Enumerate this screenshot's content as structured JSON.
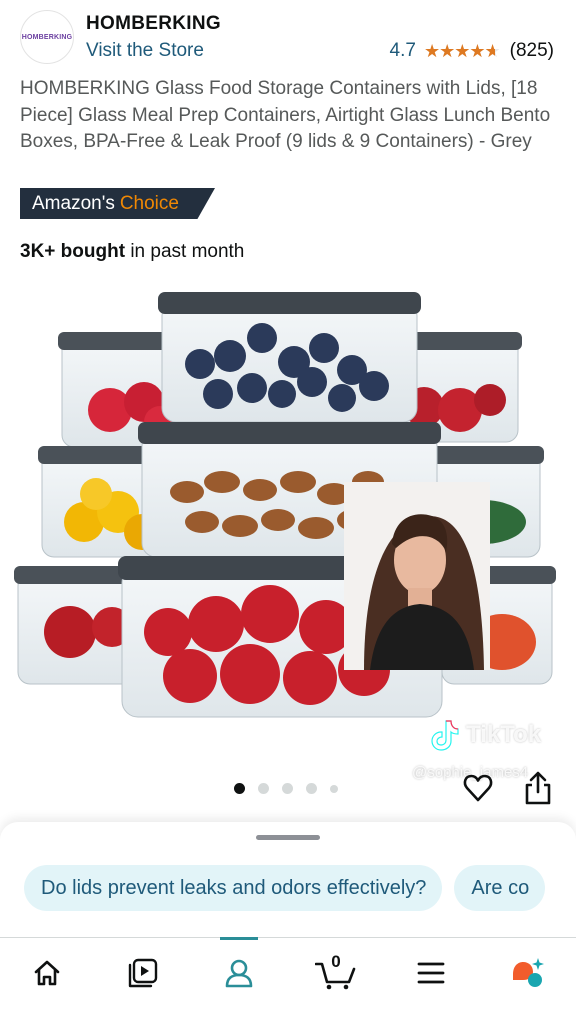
{
  "store": {
    "logo_text": "HOMBERKING",
    "name": "HOMBERKING",
    "visit_link": "Visit the Store",
    "rating_value": "4.7",
    "rating_fraction": 0.94,
    "stars_glyph": "★★★★★",
    "review_count": "(825)"
  },
  "product": {
    "title": "HOMBERKING Glass Food Storage Containers with Lids, [18 Piece] Glass Meal Prep Containers, Airtight Glass Lunch Bento Boxes, BPA-Free & Leak Proof (9 lids & 9 Containers) - Grey",
    "badge_prefix": "Amazon's",
    "badge_suffix": "Choice",
    "bought_strong": "3K+ bought",
    "bought_rest": "in past month"
  },
  "overlay": {
    "tiktok_label": "TikTok",
    "tiktok_handle": "@sophie_james4"
  },
  "carousel": {
    "count": 5,
    "active_index": 0
  },
  "questions": [
    "Do lids prevent leaks and odors effectively?",
    "Are co"
  ],
  "bottom_nav": {
    "items": [
      "home-icon",
      "video-icon",
      "account-icon",
      "cart-icon",
      "menu-icon",
      "rufus-icon"
    ],
    "active": "account-icon",
    "cart_count": "0"
  },
  "colors": {
    "link": "#1f5a7a",
    "star": "#de7921",
    "badge_bg": "#232f3e",
    "badge_accent": "#f08804",
    "chip_bg": "#e2f4f8",
    "nav_active": "#2a8e98"
  }
}
